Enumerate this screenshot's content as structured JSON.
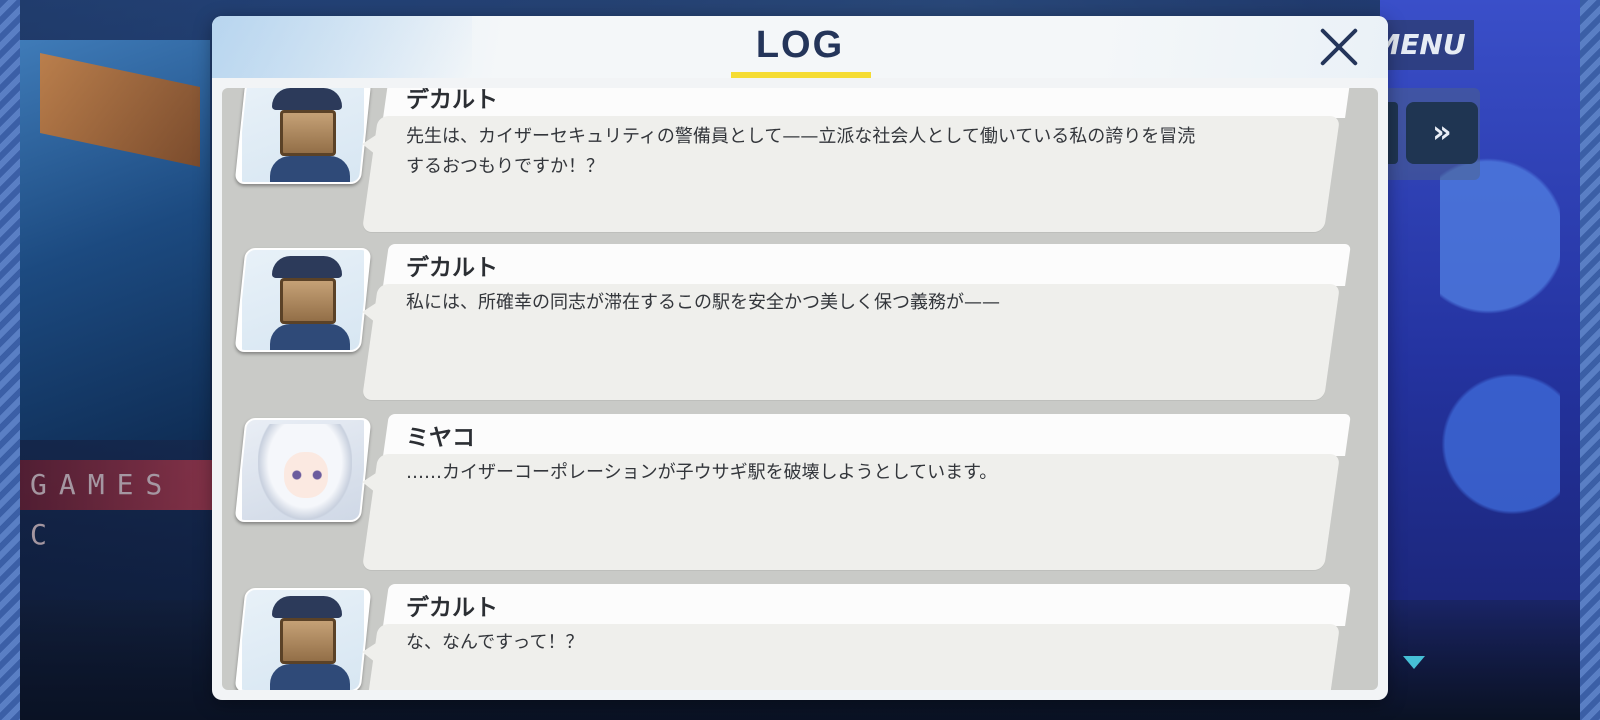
{
  "hud": {
    "menu_label": "MENU",
    "fast_forward_icon": "»"
  },
  "log": {
    "title": "LOG",
    "close_icon": "close-icon",
    "entries": [
      {
        "speaker": "デカルト",
        "avatar": "decalcomanie",
        "text": "先生は、カイザーセキュリティの警備員として——立派な社会人として働いている私の誇りを冒涜するおつもりですか！？"
      },
      {
        "speaker": "デカルト",
        "avatar": "decalcomanie",
        "text": "私には、所確幸の同志が滞在するこの駅を安全かつ美しく保つ義務が——"
      },
      {
        "speaker": "ミヤコ",
        "avatar": "miyako",
        "text": "……カイザーコーポレーションが子ウサギ駅を破壊しようとしています。"
      },
      {
        "speaker": "デカルト",
        "avatar": "decalcomanie",
        "text": "な、なんですって！？"
      }
    ]
  },
  "background": {
    "sign_text": "GAMES C"
  }
}
